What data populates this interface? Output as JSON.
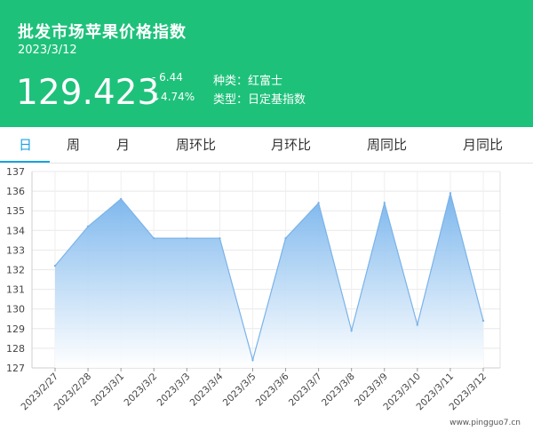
{
  "header": {
    "title": "批发市场苹果价格指数",
    "date": "2023/3/12",
    "price": "129.423",
    "change": "- 6.44",
    "change_pct": "↓4.74%",
    "variety_label": "种类：",
    "variety_value": "红富士",
    "type_label": "类型：",
    "type_value": "日定基指数",
    "bg_color": "#1ec17a"
  },
  "tabs": [
    {
      "label": "日",
      "active": true
    },
    {
      "label": "周",
      "active": false
    },
    {
      "label": "月",
      "active": false
    },
    {
      "label": "周环比",
      "active": false
    },
    {
      "label": "月环比",
      "active": false
    },
    {
      "label": "周同比",
      "active": false
    },
    {
      "label": "月同比",
      "active": false
    }
  ],
  "accent_color": "#1aa3e2",
  "watermark": "www.pingguo7.cn",
  "chart_data": {
    "type": "area",
    "x": [
      "2023/2/27",
      "2023/2/28",
      "2023/3/1",
      "2023/3/2",
      "2023/3/3",
      "2023/3/4",
      "2023/3/5",
      "2023/3/6",
      "2023/3/7",
      "2023/3/8",
      "2023/3/9",
      "2023/3/10",
      "2023/3/11",
      "2023/3/12"
    ],
    "series": [
      {
        "values": [
          132.2,
          134.2,
          135.6,
          133.6,
          133.6,
          133.6,
          127.4,
          133.6,
          135.4,
          128.9,
          135.4,
          129.2,
          135.9,
          129.4
        ]
      }
    ],
    "yticks": [
      127,
      128,
      129,
      130,
      131,
      132,
      133,
      134,
      135,
      136,
      137
    ],
    "ylim": [
      127,
      137
    ],
    "grid": true,
    "line_color": "#7ab3e8",
    "fill_top": "#74b2ec",
    "fill_bottom": "#ffffff"
  }
}
